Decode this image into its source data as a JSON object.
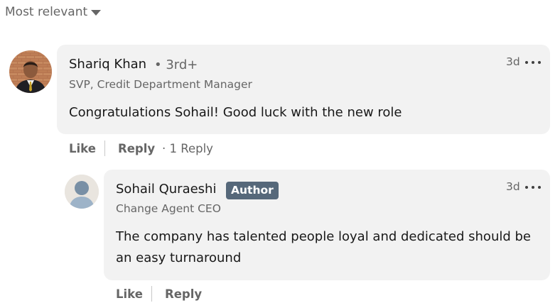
{
  "sort": {
    "label": "Most relevant"
  },
  "comments": [
    {
      "author": "Shariq Khan",
      "degree": "• 3rd+",
      "headline": "SVP, Credit Department Manager",
      "time": "3d",
      "text": "Congratulations Sohail! Good luck with the new role",
      "actions": {
        "like": "Like",
        "reply": "Reply",
        "replies": "· 1 Reply"
      }
    },
    {
      "author": "Sohail Quraeshi",
      "badge": "Author",
      "headline": "Change Agent CEO",
      "time": "3d",
      "text": "The company has talented people loyal and dedicated should be an easy turnaround",
      "actions": {
        "like": "Like",
        "reply": "Reply"
      }
    }
  ],
  "colors": {
    "bubble": "#f2f2f2",
    "badge": "#56687a",
    "secondary_text": "#666666"
  }
}
